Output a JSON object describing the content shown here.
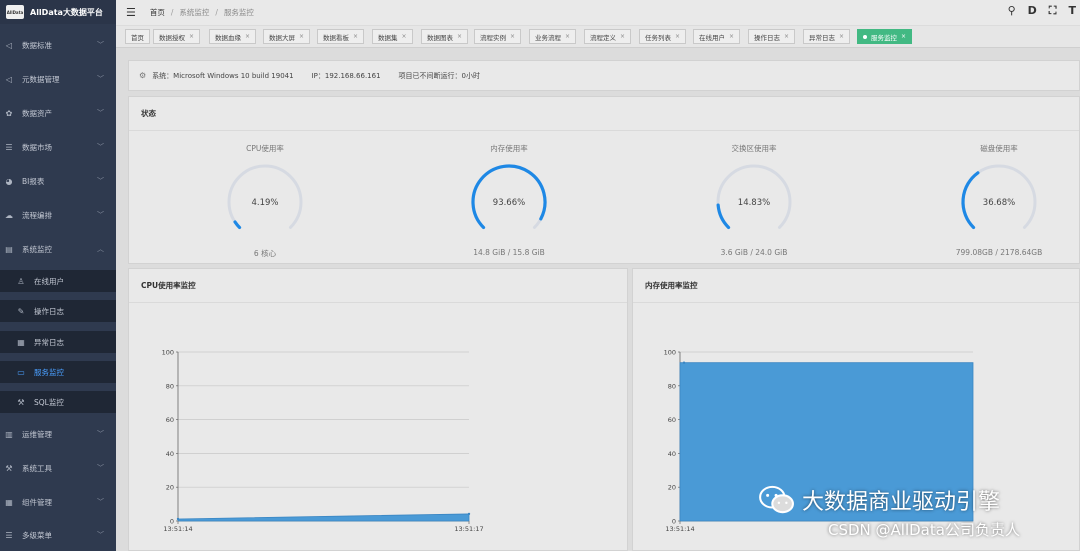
{
  "brand": {
    "logo_text": "AllData",
    "title": "AllData大数据平台"
  },
  "sidebar": {
    "items": [
      {
        "label": "数据标准",
        "icon": "send-icon",
        "glyph": "◁",
        "expandable": true
      },
      {
        "label": "元数据管理",
        "icon": "send-icon",
        "glyph": "◁",
        "expandable": true
      },
      {
        "label": "数据资产",
        "icon": "cog-icon",
        "glyph": "✿",
        "expandable": true
      },
      {
        "label": "数据市场",
        "icon": "list-icon",
        "glyph": "☰",
        "expandable": true
      },
      {
        "label": "BI报表",
        "icon": "chart-icon",
        "glyph": "◕",
        "expandable": true
      },
      {
        "label": "流程编排",
        "icon": "cloud-icon",
        "glyph": "☁",
        "expandable": true
      },
      {
        "label": "系统监控",
        "icon": "monitor-icon",
        "glyph": "▤",
        "expandable": true,
        "expanded": true
      },
      {
        "label": "在线用户",
        "icon": "user-icon",
        "glyph": "♙",
        "sub": true
      },
      {
        "label": "操作日志",
        "icon": "edit-icon",
        "glyph": "✎",
        "sub": true
      },
      {
        "label": "异常日志",
        "icon": "log-icon",
        "glyph": "▦",
        "sub": true
      },
      {
        "label": "服务监控",
        "icon": "screen-icon",
        "glyph": "▭",
        "sub": true,
        "active": true
      },
      {
        "label": "SQL监控",
        "icon": "tools-icon",
        "glyph": "⚒",
        "sub": true
      },
      {
        "label": "运维管理",
        "icon": "server-icon",
        "glyph": "▥",
        "expandable": true
      },
      {
        "label": "系统工具",
        "icon": "wrench-icon",
        "glyph": "⚒",
        "expandable": true
      },
      {
        "label": "组件管理",
        "icon": "grid-icon",
        "glyph": "▦",
        "expandable": true
      },
      {
        "label": "多级菜单",
        "icon": "menu-icon",
        "glyph": "☰",
        "expandable": true
      }
    ]
  },
  "topbar": {
    "breadcrumb": [
      "首页",
      "系统监控",
      "服务监控"
    ],
    "tools": [
      {
        "name": "search-icon",
        "glyph": "⚲"
      },
      {
        "name": "doc-icon",
        "glyph": "D"
      },
      {
        "name": "fullscreen-icon",
        "glyph": "⛶"
      },
      {
        "name": "font-size-icon",
        "glyph": "T"
      }
    ]
  },
  "tags": [
    {
      "label": "首页",
      "closable": false
    },
    {
      "label": "数据授权",
      "closable": true
    },
    {
      "label": "数据血缘",
      "closable": true
    },
    {
      "label": "数据大屏",
      "closable": true
    },
    {
      "label": "数据看板",
      "closable": true
    },
    {
      "label": "数据集",
      "closable": true
    },
    {
      "label": "数据图表",
      "closable": true
    },
    {
      "label": "流程实例",
      "closable": true
    },
    {
      "label": "业务流程",
      "closable": true
    },
    {
      "label": "流程定义",
      "closable": true
    },
    {
      "label": "任务列表",
      "closable": true
    },
    {
      "label": "在线用户",
      "closable": true
    },
    {
      "label": "操作日志",
      "closable": true
    },
    {
      "label": "异常日志",
      "closable": true
    },
    {
      "label": "服务监控",
      "closable": true,
      "active": true
    }
  ],
  "sysinfo": {
    "system": "系统：Microsoft Windows 10 build 19041",
    "ip": "IP：192.168.66.161",
    "uptime": "项目已不间断运行：0小时"
  },
  "status": {
    "title": "状态",
    "gauges": [
      {
        "title": "CPU使用率",
        "value_label": "4.19%",
        "percent": 4.19,
        "sub": "6 核心"
      },
      {
        "title": "内存使用率",
        "value_label": "93.66%",
        "percent": 93.66,
        "sub": "14.8 GiB / 15.8 GiB"
      },
      {
        "title": "交换区使用率",
        "value_label": "14.83%",
        "percent": 14.83,
        "sub": "3.6 GiB / 24.0 GiB"
      },
      {
        "title": "磁盘使用率",
        "value_label": "36.68%",
        "percent": 36.68,
        "sub": "799.08GB / 2178.64GB"
      }
    ],
    "colors": {
      "track": "#d6dae2",
      "fill": "#1e88e5"
    }
  },
  "cpu_chart": {
    "title": "CPU使用率监控"
  },
  "mem_chart": {
    "title": "内存使用率监控"
  },
  "chart_data": [
    {
      "type": "area",
      "title": "CPU使用率监控",
      "x": [
        "13:51:14",
        "13:51:17"
      ],
      "values": [
        1.2,
        4.19
      ],
      "ylim": [
        0,
        100
      ],
      "yticks": [
        0,
        20,
        40,
        60,
        80,
        100
      ],
      "color": "#4a9ad6"
    },
    {
      "type": "area",
      "title": "内存使用率监控",
      "x": [
        "13:51:14"
      ],
      "values": [
        93.66
      ],
      "ylim": [
        0,
        100
      ],
      "yticks": [
        0,
        20,
        40,
        60,
        80,
        100
      ],
      "color": "#4a9ad6"
    }
  ],
  "watermark": {
    "title": "大数据商业驱动引擎",
    "sub": "CSDN @AllData公司负责人"
  }
}
